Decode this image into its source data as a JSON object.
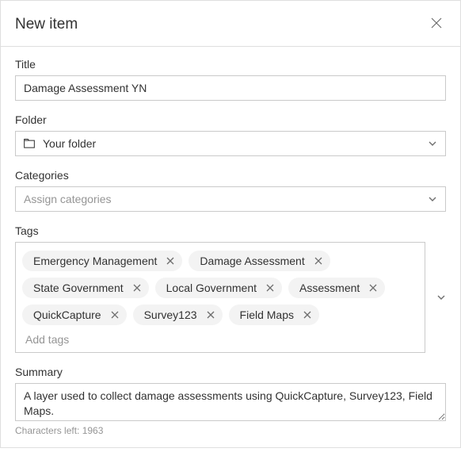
{
  "dialog": {
    "title": "New item"
  },
  "fields": {
    "title": {
      "label": "Title",
      "value": "Damage Assessment YN"
    },
    "folder": {
      "label": "Folder",
      "value": "Your folder"
    },
    "categories": {
      "label": "Categories",
      "placeholder": "Assign categories"
    },
    "tags": {
      "label": "Tags",
      "placeholder": "Add tags",
      "items": [
        "Emergency Management",
        "Damage Assessment",
        "State Government",
        "Local Government",
        "Assessment",
        "QuickCapture",
        "Survey123",
        "Field Maps"
      ]
    },
    "summary": {
      "label": "Summary",
      "value": "A layer used to collect damage assessments using QuickCapture, Survey123, Field Maps.",
      "char_count": "Characters left: 1963"
    }
  }
}
